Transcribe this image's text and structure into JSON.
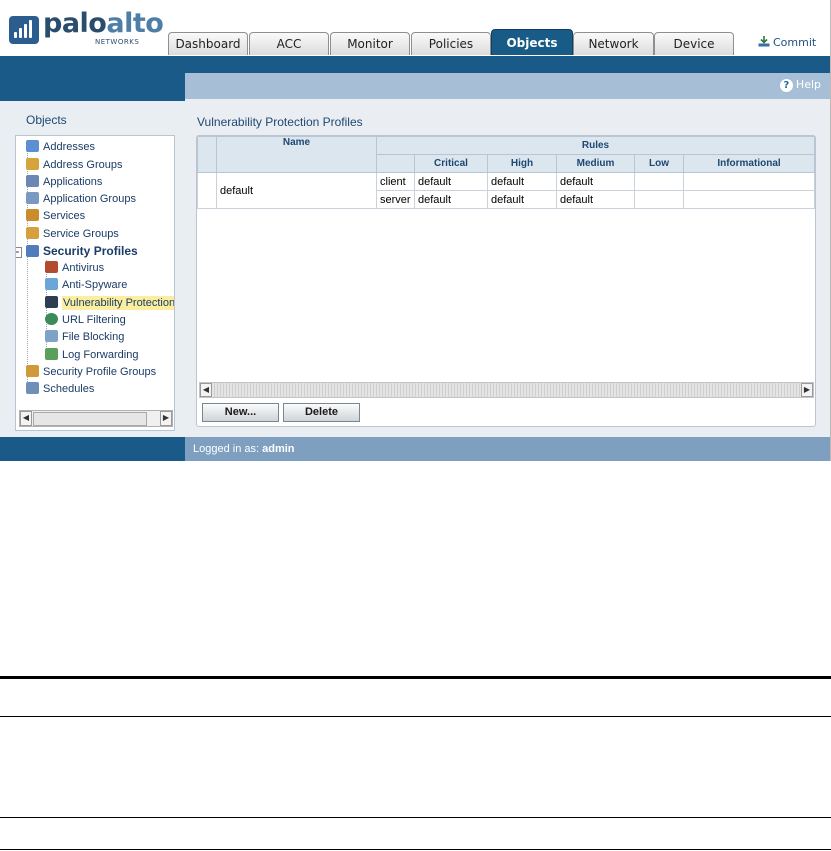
{
  "header": {
    "logo_main": "palo",
    "logo_accent": "alto",
    "logo_sub": "NETWORKS",
    "tabs": [
      {
        "label": "Dashboard"
      },
      {
        "label": "ACC"
      },
      {
        "label": "Monitor"
      },
      {
        "label": "Policies"
      },
      {
        "label": "Objects",
        "active": true
      },
      {
        "label": "Network"
      },
      {
        "label": "Device"
      }
    ],
    "commit_label": "Commit",
    "commit_icon": "commit-download-icon"
  },
  "help": {
    "label": "Help",
    "icon_glyph": "?"
  },
  "sidebar": {
    "title": "Objects",
    "items": [
      {
        "label": "Addresses",
        "icon": "addresses-icon"
      },
      {
        "label": "Address Groups",
        "icon": "address-groups-icon"
      },
      {
        "label": "Applications",
        "icon": "applications-icon"
      },
      {
        "label": "Application Groups",
        "icon": "application-groups-icon"
      },
      {
        "label": "Services",
        "icon": "services-icon"
      },
      {
        "label": "Service Groups",
        "icon": "service-groups-icon"
      },
      {
        "label": "Security Profiles",
        "icon": "security-profiles-icon",
        "expanded": true
      },
      {
        "label": "Antivirus",
        "icon": "antivirus-icon"
      },
      {
        "label": "Anti-Spyware",
        "icon": "anti-spyware-icon"
      },
      {
        "label": "Vulnerability Protection",
        "icon": "vulnerability-protection-icon",
        "selected": true
      },
      {
        "label": "URL Filtering",
        "icon": "url-filtering-icon"
      },
      {
        "label": "File Blocking",
        "icon": "file-blocking-icon"
      },
      {
        "label": "Log Forwarding",
        "icon": "log-forwarding-icon"
      },
      {
        "label": "Security Profile Groups",
        "icon": "security-profile-groups-icon"
      },
      {
        "label": "Schedules",
        "icon": "schedules-icon"
      }
    ],
    "collapse_glyph": "−"
  },
  "main": {
    "title": "Vulnerability Protection Profiles",
    "table": {
      "name_header": "Name",
      "rules_header": "Rules",
      "columns": [
        "Critical",
        "High",
        "Medium",
        "Low",
        "Informational"
      ],
      "rows": [
        {
          "name": "default",
          "rules": [
            {
              "type": "client",
              "critical": "default",
              "high": "default",
              "medium": "default",
              "low": "",
              "informational": ""
            },
            {
              "type": "server",
              "critical": "default",
              "high": "default",
              "medium": "default",
              "low": "",
              "informational": ""
            }
          ]
        }
      ]
    },
    "buttons": {
      "new_label": "New...",
      "delete_label": "Delete"
    },
    "scroll_left_glyph": "◀",
    "scroll_right_glyph": "▶"
  },
  "status": {
    "prefix": "Logged in as: ",
    "user": "admin"
  },
  "colors": {
    "brand_blue": "#195a89",
    "active_tab": "#175b86",
    "selection": "#fbef9f"
  }
}
